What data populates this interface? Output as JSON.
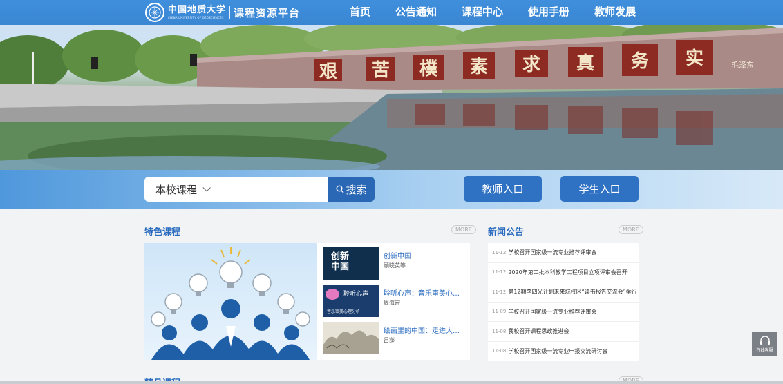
{
  "header": {
    "logo_cn": "中国地质大学",
    "logo_en": "CHINA UNIVERSITY OF GEOSCIENCES",
    "platform": "课程资源平台",
    "nav": [
      "首页",
      "公告通知",
      "课程中心",
      "使用手册",
      "教师发展"
    ]
  },
  "banner": {
    "wall_chars": [
      "艰",
      "苦",
      "樸",
      "素",
      "求",
      "真",
      "务",
      "实"
    ],
    "signature": "毛泽东"
  },
  "search": {
    "scope": "本校课程",
    "button": "搜索",
    "teacher_entry": "教师入口",
    "student_entry": "学生入口"
  },
  "featured": {
    "title": "特色课程",
    "more": "MORE",
    "courses": [
      {
        "title": "创新中国",
        "teacher": "顾晓英等",
        "thumb_text": "创新\n中国"
      },
      {
        "title": "聆听心声：音乐审美心理分析",
        "teacher": "周海宏",
        "thumb_text": "聆听心声",
        "thumb_sub": "音乐审美心理分析"
      },
      {
        "title": "绘画里的中国：走进大师与经典",
        "teacher": "吕澎"
      }
    ]
  },
  "news": {
    "title": "新闻公告",
    "more": "MORE",
    "items": [
      {
        "date": "11-12",
        "title": "学校召开国家级一流专业推荐评审会"
      },
      {
        "date": "11-12",
        "title": "2020年第二批本科教学工程项目立项评审会召开"
      },
      {
        "date": "11-12",
        "title": "第12期李四光计划未来城校区“读书报告交流会”举行"
      },
      {
        "date": "11-09",
        "title": "学校召开国家级一流专业推荐评审会"
      },
      {
        "date": "11-08",
        "title": "我校召开课程思政推进会"
      },
      {
        "date": "11-08",
        "title": "学校召开国家级一流专业申报交流研讨会"
      }
    ]
  },
  "service": {
    "label": "在线客服"
  },
  "bottom": {
    "title": "精品课程",
    "more": "MORE"
  },
  "colors": {
    "primary": "#3a86d3",
    "accent": "#2a6cbf",
    "button": "#2f72c4"
  }
}
